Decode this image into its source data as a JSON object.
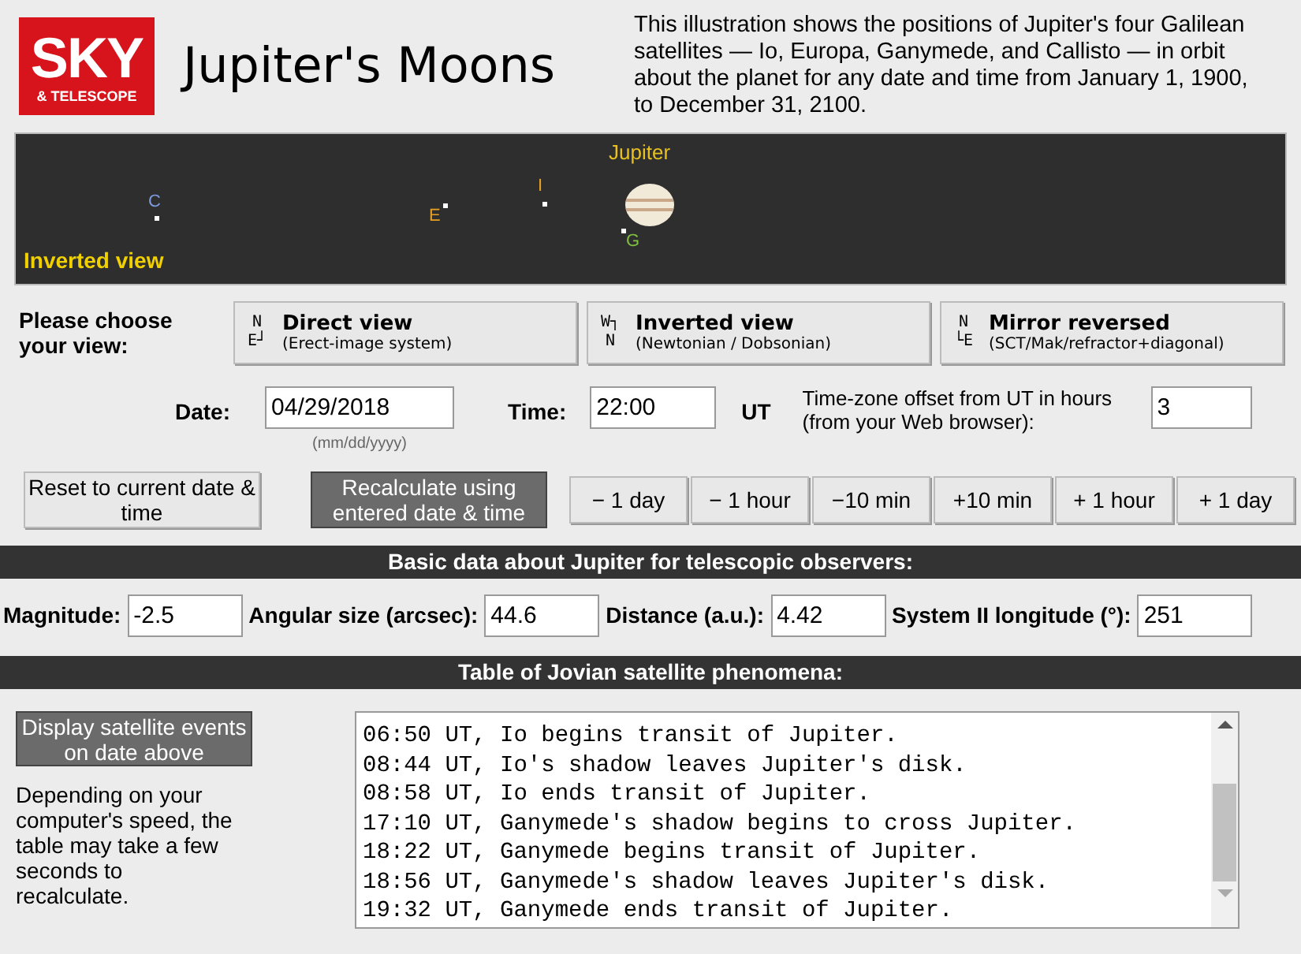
{
  "header": {
    "logo_top": "SKY",
    "logo_bottom": "& TELESCOPE",
    "title": "Jupiter's Moons",
    "description": "This illustration shows the positions of Jupiter's four Galilean satellites — Io, Europa, Ganymede, and Callisto — in orbit about the planet for any date and time from January 1, 1900, to December 31, 2100."
  },
  "plot": {
    "planet_label": "Jupiter",
    "view_label": "Inverted view",
    "moons": [
      {
        "label": "C",
        "color": "#7f9be0"
      },
      {
        "label": "E",
        "color": "#e8a020"
      },
      {
        "label": "I",
        "color": "#e8a020"
      },
      {
        "label": "G",
        "color": "#80c040"
      }
    ]
  },
  "view_choice": {
    "prompt": "Please choose your view:",
    "options": [
      {
        "title": "Direct view",
        "subtitle": "(Erect-image system)",
        "axes_top": "N",
        "axes_bottom": "E┘"
      },
      {
        "title": "Inverted view",
        "subtitle": "(Newtonian / Dobsonian)",
        "axes_top": "W┐",
        "axes_bottom": "N"
      },
      {
        "title": "Mirror reversed",
        "subtitle": "(SCT/Mak/refractor+diagonal)",
        "axes_top": "N",
        "axes_bottom": "└E"
      }
    ]
  },
  "datetime": {
    "date_label": "Date:",
    "date_value": "04/29/2018",
    "date_hint": "(mm/dd/yyyy)",
    "time_label": "Time:",
    "time_value": "22:00",
    "time_unit": "UT",
    "offset_label": "Time-zone offset from UT in hours (from your Web browser):",
    "offset_value": "3"
  },
  "actions": {
    "reset": "Reset to current date & time",
    "recalculate": "Recalculate using entered date & time",
    "steps": [
      "− 1 day",
      "− 1 hour",
      "−10 min",
      "+10 min",
      "+ 1 hour",
      "+ 1 day"
    ]
  },
  "basic_data": {
    "heading": "Basic data about Jupiter for telescopic observers:",
    "fields": [
      {
        "label": "Magnitude:",
        "value": "-2.5"
      },
      {
        "label": "Angular size (arcsec):",
        "value": "44.6"
      },
      {
        "label": "Distance (a.u.):",
        "value": "4.42"
      },
      {
        "label": "System II longitude (°):",
        "value": "251"
      }
    ]
  },
  "phenomena": {
    "heading": "Table of Jovian satellite phenomena:",
    "button": "Display satellite events on date above",
    "note": "Depending on your computer's speed, the table may take a few seconds to recalculate.",
    "lines": [
      "06:50 UT, Io begins transit of Jupiter.",
      "08:44 UT, Io's shadow leaves Jupiter's disk.",
      "08:58 UT, Io ends transit of Jupiter.",
      "17:10 UT, Ganymede's shadow begins to cross Jupiter.",
      "18:22 UT, Ganymede begins transit of Jupiter.",
      "18:56 UT, Ganymede's shadow leaves Jupiter's disk.",
      "19:32 UT, Ganymede ends transit of Jupiter."
    ]
  }
}
